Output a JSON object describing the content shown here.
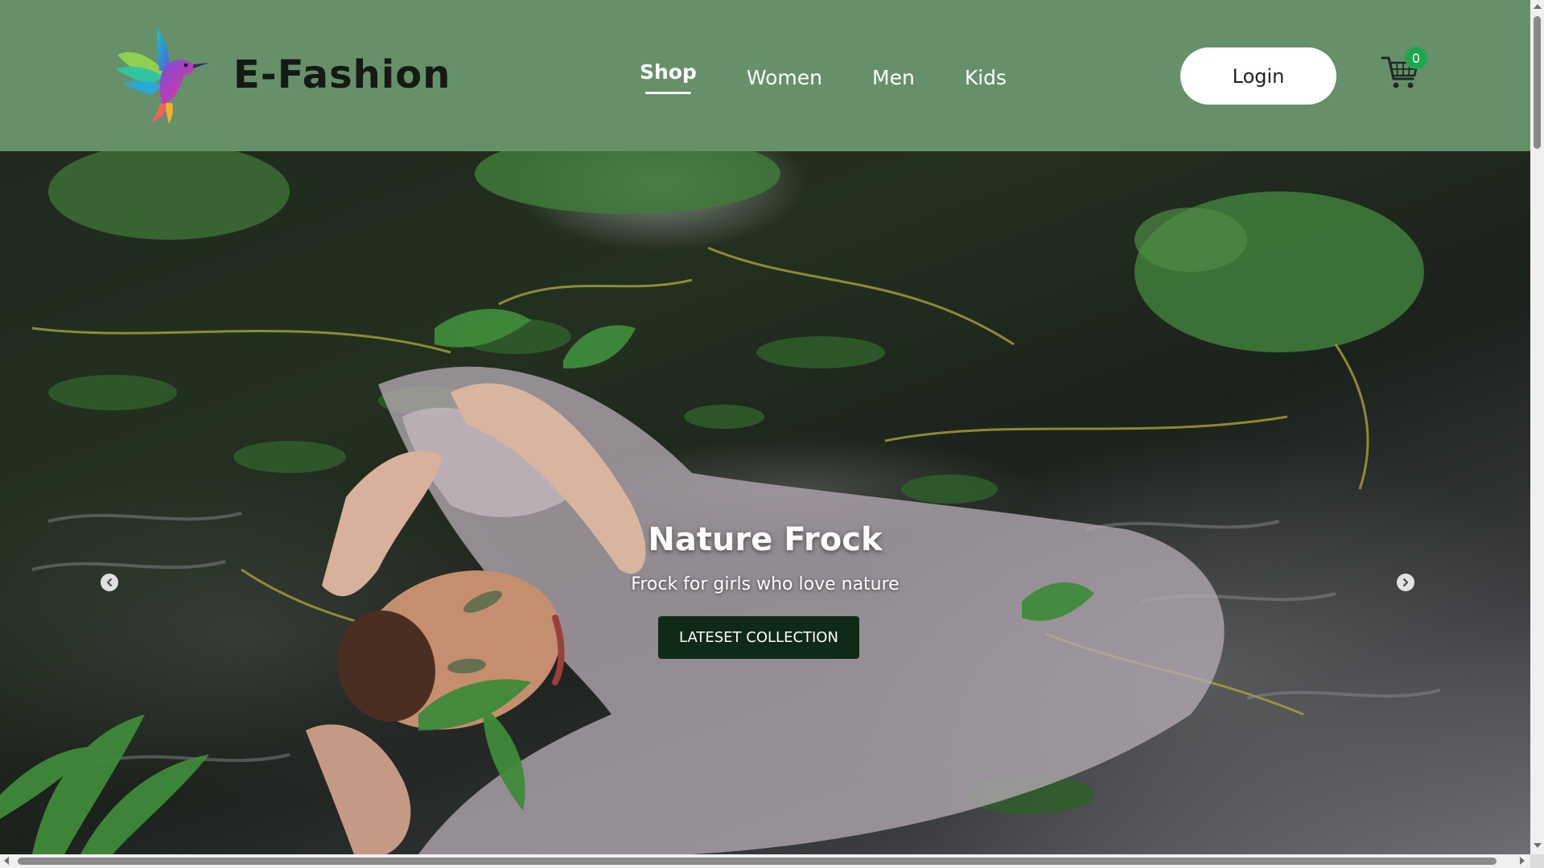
{
  "header": {
    "brand_name": "E-Fashion",
    "logo_icon": "hummingbird-logo-icon",
    "background_color": "#66906a"
  },
  "nav": {
    "items": [
      {
        "label": "Shop",
        "active": true
      },
      {
        "label": "Women",
        "active": false
      },
      {
        "label": "Men",
        "active": false
      },
      {
        "label": "Kids",
        "active": false
      }
    ]
  },
  "auth": {
    "login_label": "Login"
  },
  "cart": {
    "icon": "shopping-cart-icon",
    "count": "0",
    "badge_color": "#1fa84b"
  },
  "hero": {
    "title": "Nature Frock",
    "subtitle": "Frock for girls who love nature",
    "cta_label": "LATESET COLLECTION",
    "cta_color": "#0f2a17",
    "prev_icon": "chevron-left-icon",
    "next_icon": "chevron-right-icon"
  }
}
